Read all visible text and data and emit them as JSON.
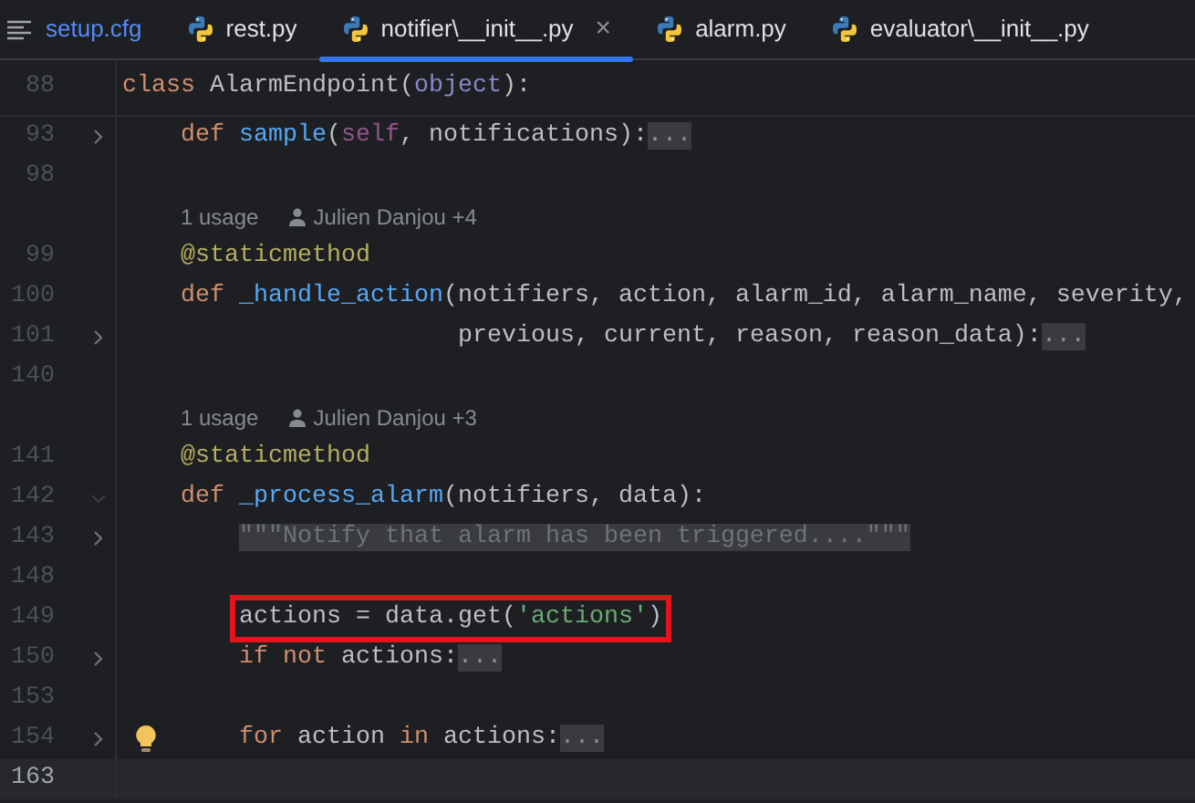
{
  "tabs": [
    {
      "label": "setup.cfg",
      "kind": "config",
      "modified": true,
      "selected": false
    },
    {
      "label": "rest.py",
      "kind": "python",
      "modified": false,
      "selected": false
    },
    {
      "label": "notifier\\__init__.py",
      "kind": "python",
      "modified": false,
      "selected": true,
      "close": "×"
    },
    {
      "label": "alarm.py",
      "kind": "python",
      "modified": false,
      "selected": false
    },
    {
      "label": "evaluator\\__init__.py",
      "kind": "python",
      "modified": false,
      "selected": false
    }
  ],
  "sticky_line": {
    "number": "88",
    "tokens": [
      {
        "kind": "kw",
        "text": "class "
      },
      {
        "kind": "plain",
        "text": "AlarmEndpoint("
      },
      {
        "kind": "builtin",
        "text": "object"
      },
      {
        "kind": "plain",
        "text": "):"
      }
    ],
    "children": [
      {
        "kind": "code",
        "number": "93",
        "collapsed": true,
        "tokens": [
          {
            "kind": "kw",
            "text": "def "
          },
          {
            "kind": "fn",
            "text": "sample"
          },
          {
            "kind": "plain",
            "text": "("
          },
          {
            "kind": "self",
            "text": "self"
          },
          {
            "kind": "plain",
            "text": ", notifications):"
          },
          {
            "kind": "folded",
            "text": "..."
          }
        ]
      },
      {
        "kind": "code",
        "number": "98"
      },
      {
        "kind": "hint",
        "usage": "1 usage",
        "author": "Julien Danjou +4"
      },
      {
        "kind": "code",
        "number": "99",
        "tokens": [
          {
            "kind": "deco",
            "text": "@staticmethod"
          }
        ]
      },
      {
        "kind": "code",
        "number": "100",
        "tokens": [
          {
            "kind": "kw",
            "text": "def "
          },
          {
            "kind": "fn",
            "text": "_handle_action"
          },
          {
            "kind": "plain",
            "text": "(notifiers, action, alarm_id, alarm_name, severity,"
          }
        ]
      },
      {
        "kind": "continuation",
        "number": "101",
        "collapsed": true,
        "tokens": [
          {
            "kind": "plain",
            "text": "previous, current, reason, reason_data):"
          },
          {
            "kind": "folded",
            "text": "..."
          }
        ]
      },
      {
        "kind": "code",
        "number": "140"
      },
      {
        "kind": "hint",
        "usage": "1 usage",
        "author": "Julien Danjou +3"
      },
      {
        "kind": "code",
        "number": "141",
        "tokens": [
          {
            "kind": "deco",
            "text": "@staticmethod"
          }
        ]
      },
      {
        "kind": "code",
        "number": "142",
        "collapsed": false,
        "tokens": [
          {
            "kind": "kw",
            "text": "def "
          },
          {
            "kind": "fn",
            "text": "_process_alarm"
          },
          {
            "kind": "plain",
            "text": "(notifiers, data):"
          }
        ],
        "children": [
          {
            "kind": "code",
            "number": "143",
            "collapsed": true,
            "tokens": [
              {
                "kind": "doc",
                "text": "\"\"\"Notify that alarm has been triggered....\"\"\""
              }
            ]
          },
          {
            "kind": "code",
            "number": "148"
          },
          {
            "kind": "code",
            "number": "149",
            "highlighted": true,
            "tokens": [
              {
                "kind": "plain",
                "text": "actions = data.get("
              },
              {
                "kind": "str",
                "text": "'actions'"
              },
              {
                "kind": "plain",
                "text": ")"
              }
            ]
          },
          {
            "kind": "code",
            "number": "150",
            "collapsed": true,
            "tokens": [
              {
                "kind": "kw",
                "text": "if not "
              },
              {
                "kind": "plain",
                "text": "actions:"
              },
              {
                "kind": "folded",
                "text": "..."
              }
            ]
          },
          {
            "kind": "code",
            "number": "153"
          },
          {
            "kind": "code",
            "number": "154",
            "collapsed": true,
            "bulb": true,
            "tokens": [
              {
                "kind": "kw",
                "text": "for "
              },
              {
                "kind": "plain",
                "text": "action "
              },
              {
                "kind": "kw",
                "text": "in "
              },
              {
                "kind": "plain",
                "text": "actions:"
              },
              {
                "kind": "folded",
                "text": "..."
              }
            ]
          },
          {
            "kind": "code",
            "number": "163",
            "current": true
          }
        ]
      }
    ]
  }
}
